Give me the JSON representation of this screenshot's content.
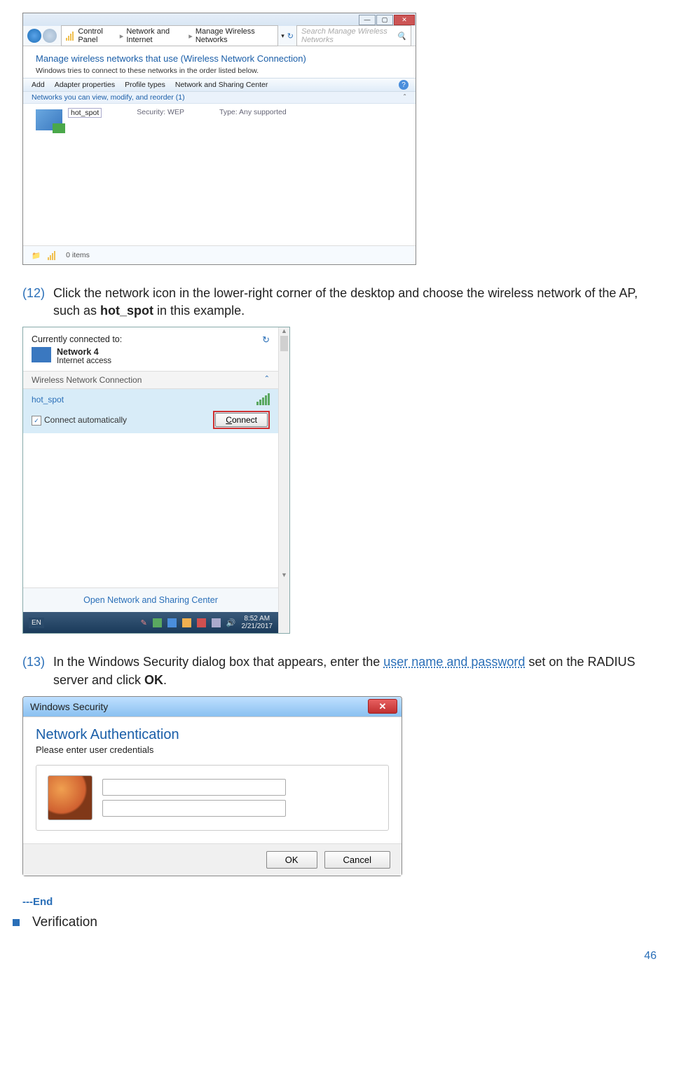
{
  "cp": {
    "breadcrumb": [
      "Control Panel",
      "Network and Internet",
      "Manage Wireless Networks"
    ],
    "search_placeholder": "Search Manage Wireless Networks",
    "heading": "Manage wireless networks that use (Wireless Network Connection)",
    "subheading": "Windows tries to connect to these networks in the order listed below.",
    "toolbar": [
      "Add",
      "Adapter properties",
      "Profile types",
      "Network and Sharing Center"
    ],
    "group_label": "Networks you can view, modify, and reorder (1)",
    "item": {
      "name": "hot_spot",
      "security": "Security: WEP",
      "type": "Type: Any supported"
    },
    "status": "0 items"
  },
  "step12": {
    "num": "(12)",
    "text_a": "Click the network icon in the lower-right corner of the desktop and choose the wireless network of the AP, such as ",
    "bold": "hot_spot",
    "text_b": " in this example."
  },
  "tray": {
    "head": "Currently connected to:",
    "net_name": "Network 4",
    "net_desc": "Internet access",
    "section": "Wireless Network Connection",
    "item": "hot_spot",
    "auto": "Connect automatically",
    "connect": "Connect",
    "link": "Open Network and Sharing Center",
    "lang": "EN",
    "time": "8:52 AM",
    "date": "2/21/2017"
  },
  "step13": {
    "num": "(13)",
    "text_a": "In the Windows Security dialog box that appears, enter the ",
    "link": "user name and password",
    "text_b": " set on the RADIUS server and click ",
    "bold": "OK",
    "text_c": "."
  },
  "sec": {
    "title": "Windows Security",
    "heading": "Network Authentication",
    "sub": "Please enter user credentials",
    "ok": "OK",
    "cancel": "Cancel"
  },
  "end": "---End",
  "verif": "Verification",
  "page": "46"
}
